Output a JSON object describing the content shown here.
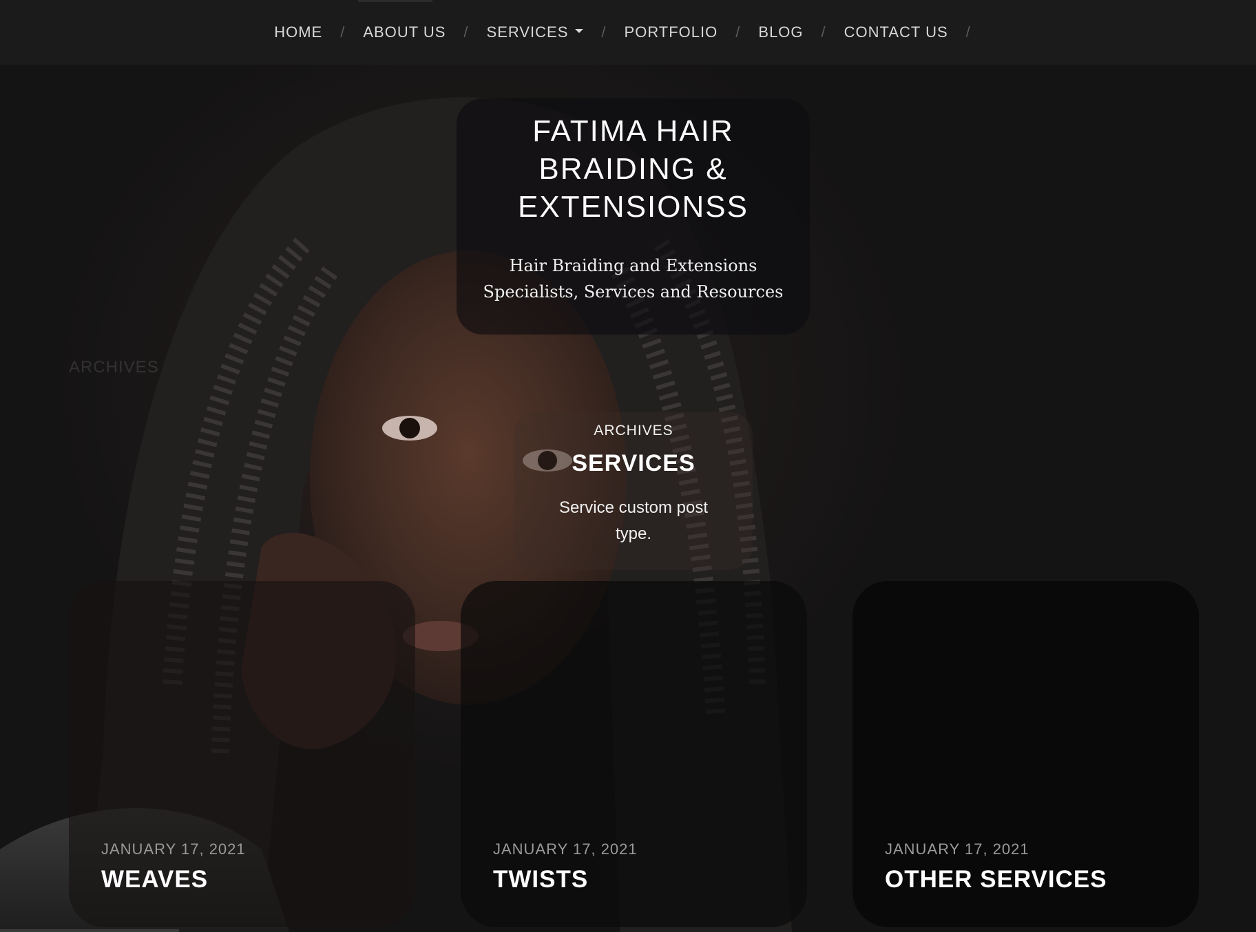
{
  "nav": {
    "items": [
      {
        "label": "HOME"
      },
      {
        "label": "ABOUT US"
      },
      {
        "label": "SERVICES",
        "has_dropdown": true
      },
      {
        "label": "PORTFOLIO"
      },
      {
        "label": "BLOG"
      },
      {
        "label": "CONTACT US"
      }
    ],
    "separator": "/"
  },
  "site": {
    "title": "FATIMA HAIR BRAIDING & EXTENSIONSS",
    "tagline": "Hair Braiding and Extensions Specialists, Services and Resources"
  },
  "ghost_label": "ARCHIVES",
  "archive": {
    "kicker": "ARCHIVES",
    "title": "SERVICES",
    "description": "Service custom post type."
  },
  "cards": [
    {
      "date": "JANUARY 17, 2021",
      "title": "WEAVES"
    },
    {
      "date": "JANUARY 17, 2021",
      "title": "TWISTS"
    },
    {
      "date": "JANUARY 17, 2021",
      "title": "OTHER SERVICES"
    }
  ],
  "colors": {
    "nav_background": "#1b1b1b",
    "page_background": "#161616",
    "text_primary": "#ffffff",
    "text_muted": "#9a9a9a"
  }
}
